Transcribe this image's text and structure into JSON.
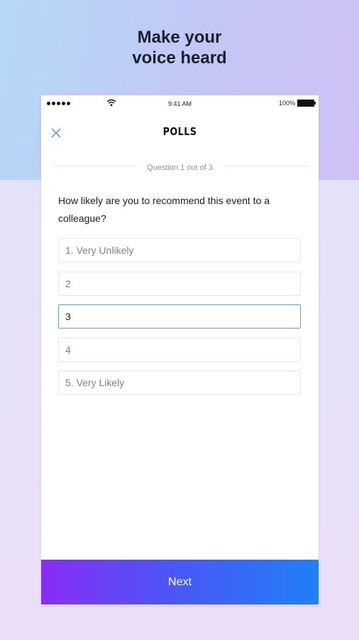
{
  "headline": {
    "line1": "Make your",
    "line2": "voice heard"
  },
  "status_bar": {
    "time": "9:41 AM",
    "battery": "100%"
  },
  "nav": {
    "title": "POLLS",
    "close_icon": "close-icon"
  },
  "progress": {
    "label": "Question 1 out of 3"
  },
  "question": {
    "text": "How likely are you to recommend this event to a colleague?"
  },
  "options": [
    {
      "label": "1. Very Unlikely",
      "selected": false
    },
    {
      "label": "2",
      "selected": false
    },
    {
      "label": "3",
      "selected": true
    },
    {
      "label": "4",
      "selected": false
    },
    {
      "label": "5. Very Likely",
      "selected": false
    }
  ],
  "actions": {
    "next_label": "Next"
  },
  "colors": {
    "accent_start": "#8a2cf5",
    "accent_end": "#1f7ff6",
    "selected_border": "#6a9fd3"
  }
}
